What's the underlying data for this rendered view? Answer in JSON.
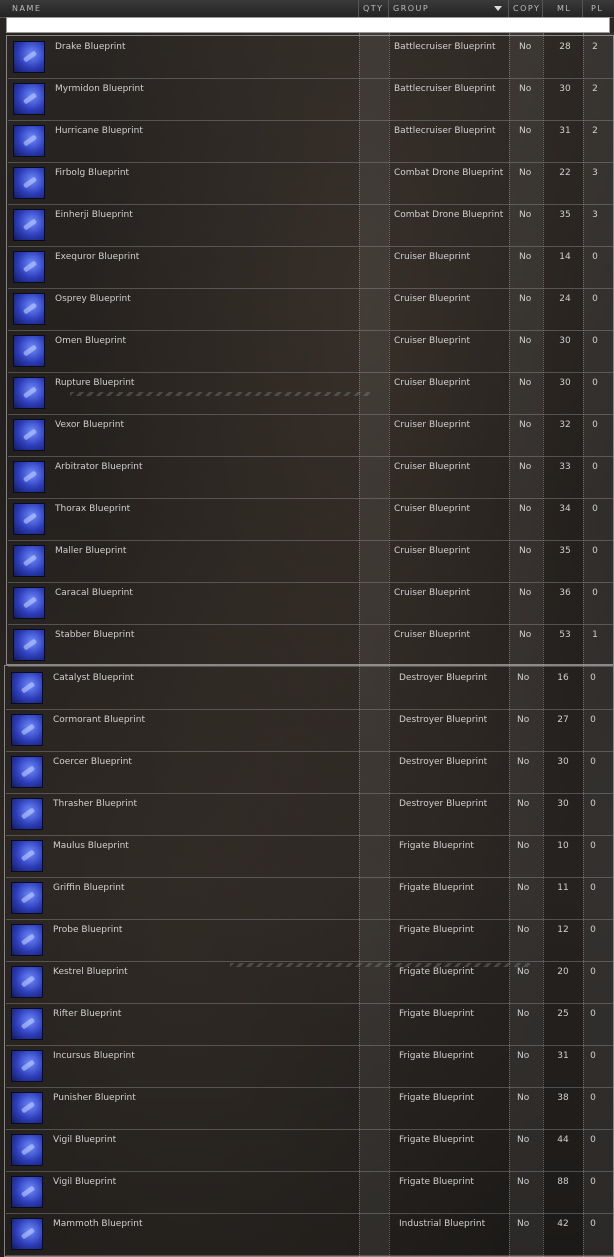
{
  "columns": {
    "name": "NAME",
    "qty": "QTY",
    "group": "GROUP",
    "copy": "COPY",
    "ml": "ML",
    "pl": "PL"
  },
  "filter_value": "",
  "rows_section1": [
    {
      "name": "Drake Blueprint",
      "group": "Battlecruiser Blueprint",
      "copy": "No",
      "ml": "28",
      "pl": "2"
    },
    {
      "name": "Myrmidon Blueprint",
      "group": "Battlecruiser Blueprint",
      "copy": "No",
      "ml": "30",
      "pl": "2"
    },
    {
      "name": "Hurricane Blueprint",
      "group": "Battlecruiser Blueprint",
      "copy": "No",
      "ml": "31",
      "pl": "2"
    },
    {
      "name": "Firbolg Blueprint",
      "group": "Combat Drone Blueprint",
      "copy": "No",
      "ml": "22",
      "pl": "3"
    },
    {
      "name": "Einherji Blueprint",
      "group": "Combat Drone Blueprint",
      "copy": "No",
      "ml": "35",
      "pl": "3"
    },
    {
      "name": "Exequror Blueprint",
      "group": "Cruiser Blueprint",
      "copy": "No",
      "ml": "14",
      "pl": "0"
    },
    {
      "name": "Osprey Blueprint",
      "group": "Cruiser Blueprint",
      "copy": "No",
      "ml": "24",
      "pl": "0"
    },
    {
      "name": "Omen Blueprint",
      "group": "Cruiser Blueprint",
      "copy": "No",
      "ml": "30",
      "pl": "0"
    },
    {
      "name": "Rupture Blueprint",
      "group": "Cruiser Blueprint",
      "copy": "No",
      "ml": "30",
      "pl": "0"
    },
    {
      "name": "Vexor Blueprint",
      "group": "Cruiser Blueprint",
      "copy": "No",
      "ml": "32",
      "pl": "0"
    },
    {
      "name": "Arbitrator Blueprint",
      "group": "Cruiser Blueprint",
      "copy": "No",
      "ml": "33",
      "pl": "0"
    },
    {
      "name": "Thorax Blueprint",
      "group": "Cruiser Blueprint",
      "copy": "No",
      "ml": "34",
      "pl": "0"
    },
    {
      "name": "Maller Blueprint",
      "group": "Cruiser Blueprint",
      "copy": "No",
      "ml": "35",
      "pl": "0"
    },
    {
      "name": "Caracal Blueprint",
      "group": "Cruiser Blueprint",
      "copy": "No",
      "ml": "36",
      "pl": "0"
    },
    {
      "name": "Stabber Blueprint",
      "group": "Cruiser Blueprint",
      "copy": "No",
      "ml": "53",
      "pl": "1"
    }
  ],
  "rows_section2": [
    {
      "name": "Catalyst Blueprint",
      "group": "Destroyer Blueprint",
      "copy": "No",
      "ml": "16",
      "pl": "0"
    },
    {
      "name": "Cormorant Blueprint",
      "group": "Destroyer Blueprint",
      "copy": "No",
      "ml": "27",
      "pl": "0"
    },
    {
      "name": "Coercer Blueprint",
      "group": "Destroyer Blueprint",
      "copy": "No",
      "ml": "30",
      "pl": "0"
    },
    {
      "name": "Thrasher Blueprint",
      "group": "Destroyer Blueprint",
      "copy": "No",
      "ml": "30",
      "pl": "0"
    },
    {
      "name": "Maulus Blueprint",
      "group": "Frigate Blueprint",
      "copy": "No",
      "ml": "10",
      "pl": "0"
    },
    {
      "name": "Griffin Blueprint",
      "group": "Frigate Blueprint",
      "copy": "No",
      "ml": "11",
      "pl": "0"
    },
    {
      "name": "Probe Blueprint",
      "group": "Frigate Blueprint",
      "copy": "No",
      "ml": "12",
      "pl": "0"
    },
    {
      "name": "Kestrel Blueprint",
      "group": "Frigate Blueprint",
      "copy": "No",
      "ml": "20",
      "pl": "0"
    },
    {
      "name": "Rifter Blueprint",
      "group": "Frigate Blueprint",
      "copy": "No",
      "ml": "25",
      "pl": "0"
    },
    {
      "name": "Incursus Blueprint",
      "group": "Frigate Blueprint",
      "copy": "No",
      "ml": "31",
      "pl": "0"
    },
    {
      "name": "Punisher Blueprint",
      "group": "Frigate Blueprint",
      "copy": "No",
      "ml": "38",
      "pl": "0"
    },
    {
      "name": "Vigil Blueprint",
      "group": "Frigate Blueprint",
      "copy": "No",
      "ml": "44",
      "pl": "0"
    },
    {
      "name": "Vigil Blueprint",
      "group": "Frigate Blueprint",
      "copy": "No",
      "ml": "88",
      "pl": "0"
    },
    {
      "name": "Mammoth Blueprint",
      "group": "Industrial Blueprint",
      "copy": "No",
      "ml": "42",
      "pl": "0"
    }
  ],
  "colors": {
    "accent": "#3b4fd6",
    "text": "#d0d0d0",
    "row_border": "#8c8c8c"
  }
}
